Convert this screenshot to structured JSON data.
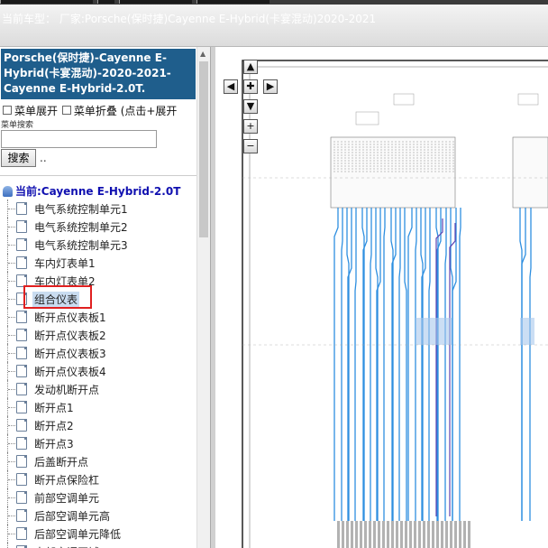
{
  "header": {
    "car_label": "当前车型：",
    "car_value": "厂家:Porsche(保时捷)Cayenne E-Hybrid(卡宴混动)2020-2021"
  },
  "sidebar": {
    "title": "Porsche(保时捷)-Cayenne E-Hybrid(卡宴混动)-2020-2021- Cayenne E-Hybrid-2.0T.",
    "menu_expand": "菜单展开",
    "menu_collapse": "菜单折叠",
    "menu_hint": "(点击+展开",
    "search_label": "菜单搜索",
    "search_placeholder": "",
    "search_button": "搜索",
    "search_dots": "..",
    "current_label": "当前:Cayenne E-Hybrid-2.0T",
    "items": [
      {
        "label": "电气系统控制单元1"
      },
      {
        "label": "电气系统控制单元2"
      },
      {
        "label": "电气系统控制单元3"
      },
      {
        "label": "车内灯表单1"
      },
      {
        "label": "车内灯表单2"
      },
      {
        "label": "组合仪表",
        "selected": true
      },
      {
        "label": "断开点仪表板1"
      },
      {
        "label": "断开点仪表板2"
      },
      {
        "label": "断开点仪表板3"
      },
      {
        "label": "断开点仪表板4"
      },
      {
        "label": "发动机断开点"
      },
      {
        "label": "断开点1"
      },
      {
        "label": "断开点2"
      },
      {
        "label": "断开点3"
      },
      {
        "label": "后盖断开点"
      },
      {
        "label": "断开点保险杠"
      },
      {
        "label": "前部空调单元"
      },
      {
        "label": "后部空调单元高"
      },
      {
        "label": "后部空调单元降低"
      },
      {
        "label": "中部空调区域"
      }
    ]
  },
  "diagram_controls": {
    "up": "▲",
    "left": "◀",
    "center": "✚",
    "right": "▶",
    "down": "▼",
    "zoom_in": "+",
    "zoom_out": "−"
  },
  "colors": {
    "title_bg": "#1f5e8c",
    "current_text": "#1010b0",
    "wire": "#2e8fe0",
    "highlight": "#e02020"
  }
}
